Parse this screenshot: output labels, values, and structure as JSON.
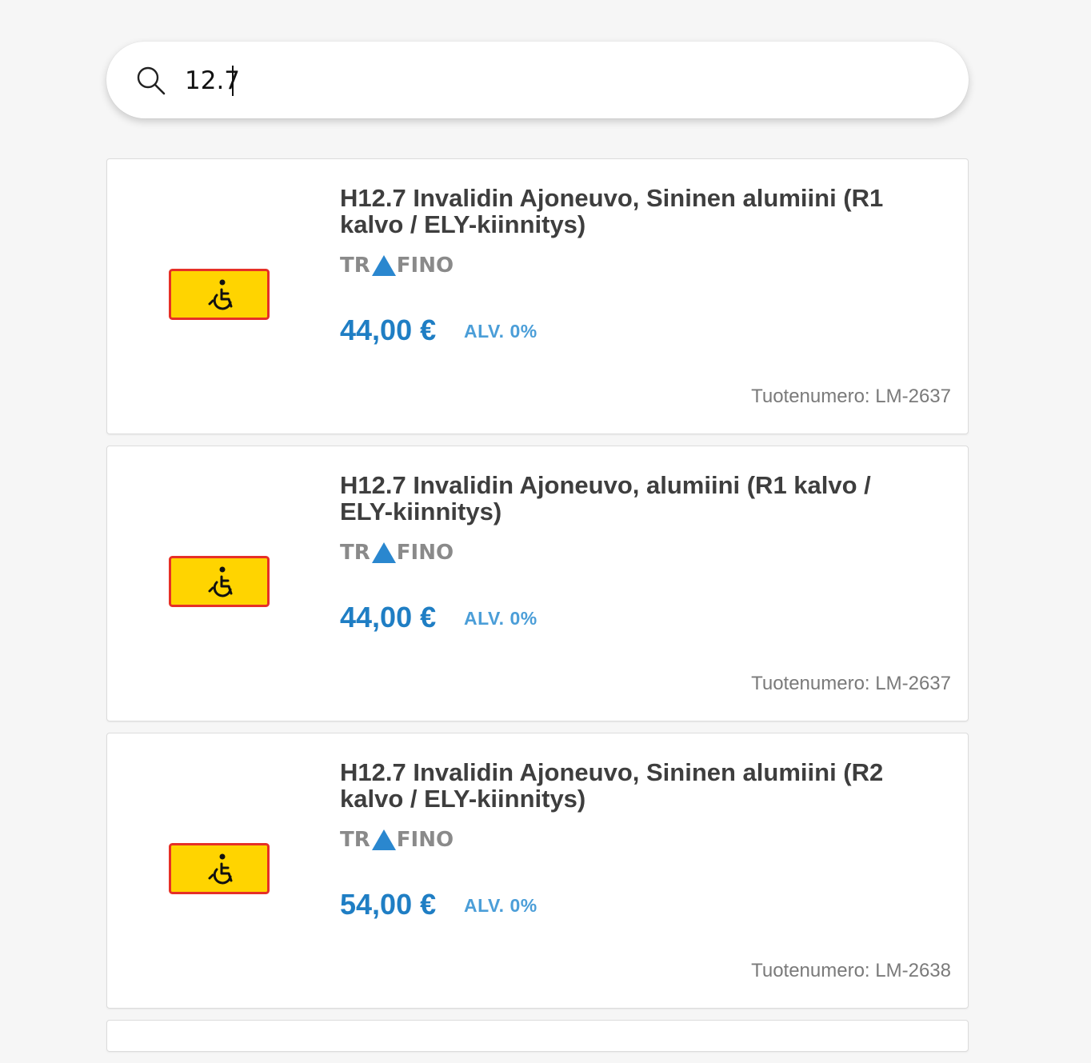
{
  "search": {
    "value": "12.7"
  },
  "results": [
    {
      "title": "H12.7 Invalidin Ajoneuvo, Sininen alumiini (R1 kalvo / ELY-kiinnitys)",
      "brand_left": "TR",
      "brand_right": "FINO",
      "price": "44,00 €",
      "vat": "ALV. 0%",
      "sku": "Tuotenumero: LM-2637"
    },
    {
      "title": "H12.7 Invalidin Ajoneuvo, alumiini (R1 kalvo / ELY-kiinnitys)",
      "brand_left": "TR",
      "brand_right": "FINO",
      "price": "44,00 €",
      "vat": "ALV. 0%",
      "sku": "Tuotenumero: LM-2637"
    },
    {
      "title": "H12.7 Invalidin Ajoneuvo, Sininen alumiini (R2 kalvo / ELY-kiinnitys)",
      "brand_left": "TR",
      "brand_right": "FINO",
      "price": "54,00 €",
      "vat": "ALV. 0%",
      "sku": "Tuotenumero: LM-2638"
    }
  ],
  "colors": {
    "price": "#1f7ec4",
    "brand_triangle": "#2a87cf",
    "sign_yellow": "#ffd400",
    "sign_border": "#e63027"
  },
  "icons": {
    "search": "search-icon",
    "product": "wheelchair-sign-icon"
  }
}
